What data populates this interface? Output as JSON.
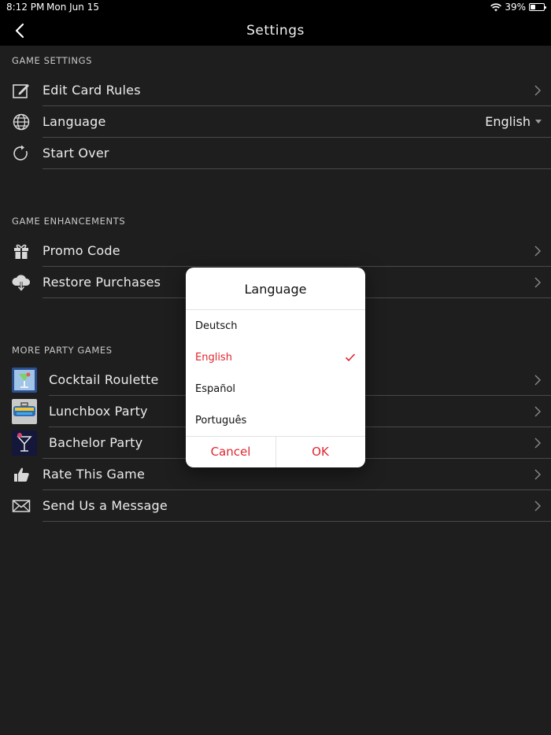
{
  "status_bar": {
    "time": "8:12 PM",
    "date": "Mon Jun 15",
    "battery": "39%",
    "battery_level": 0.39
  },
  "nav": {
    "title": "Settings",
    "back_icon": "chevron-left-icon"
  },
  "sections": {
    "game_settings": "GAME SETTINGS",
    "game_enhancements": "GAME ENHANCEMENTS",
    "more_party_games": "MORE PARTY GAMES"
  },
  "rows": {
    "edit_card_rules": "Edit Card Rules",
    "language": "Language",
    "language_value": "English",
    "start_over": "Start Over",
    "promo_code": "Promo Code",
    "restore_purchases": "Restore Purchases",
    "cocktail_roulette": "Cocktail Roulette",
    "lunchbox_party": "Lunchbox Party",
    "bachelor_party": "Bachelor Party",
    "rate_this_game": "Rate This Game",
    "send_message": "Send Us a Message"
  },
  "dialog": {
    "title": "Language",
    "options": [
      "Deutsch",
      "English",
      "Español",
      "Português"
    ],
    "selected": "English",
    "cancel": "Cancel",
    "ok": "OK"
  },
  "colors": {
    "accent": "#e0262e",
    "background": "#1e1e1e",
    "bar": "#000000"
  }
}
